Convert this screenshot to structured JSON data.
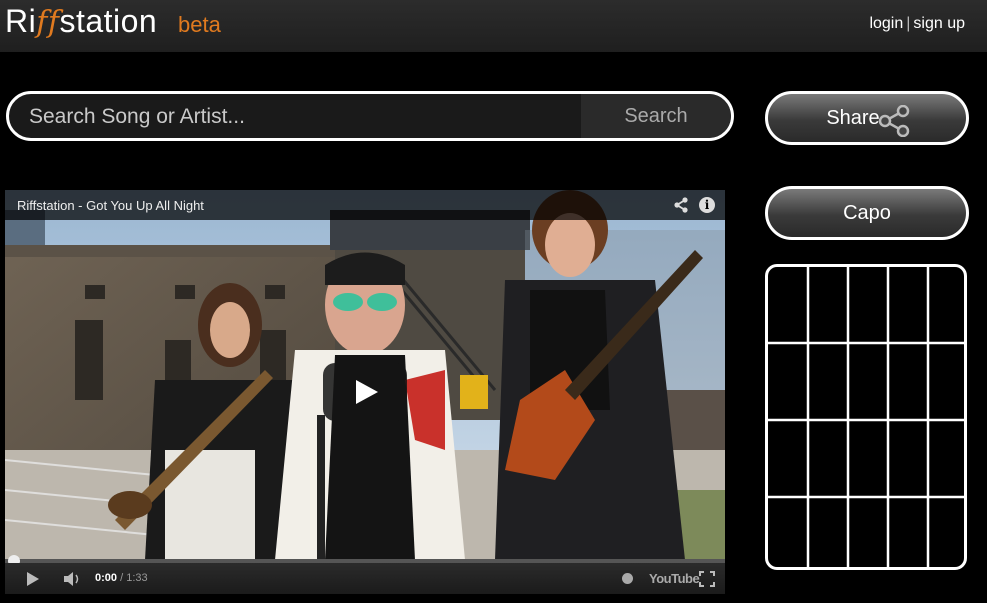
{
  "header": {
    "logo_part1": "Ri",
    "logo_ff": "ff",
    "logo_part2": "station",
    "beta": "beta",
    "login": "login",
    "separator": "|",
    "signup": "sign up"
  },
  "search": {
    "placeholder": "Search Song or Artist...",
    "button": "Search"
  },
  "sidebar": {
    "share": "Share",
    "capo": "Capo"
  },
  "video": {
    "title": "Riffstation - Got You Up All Night",
    "time_current": "0:00",
    "time_separator": "/",
    "time_total": "1:33",
    "brand": "YouTube",
    "progress": 0
  },
  "colors": {
    "accent": "#e07a1f",
    "background": "#000000",
    "header": "#262626"
  }
}
